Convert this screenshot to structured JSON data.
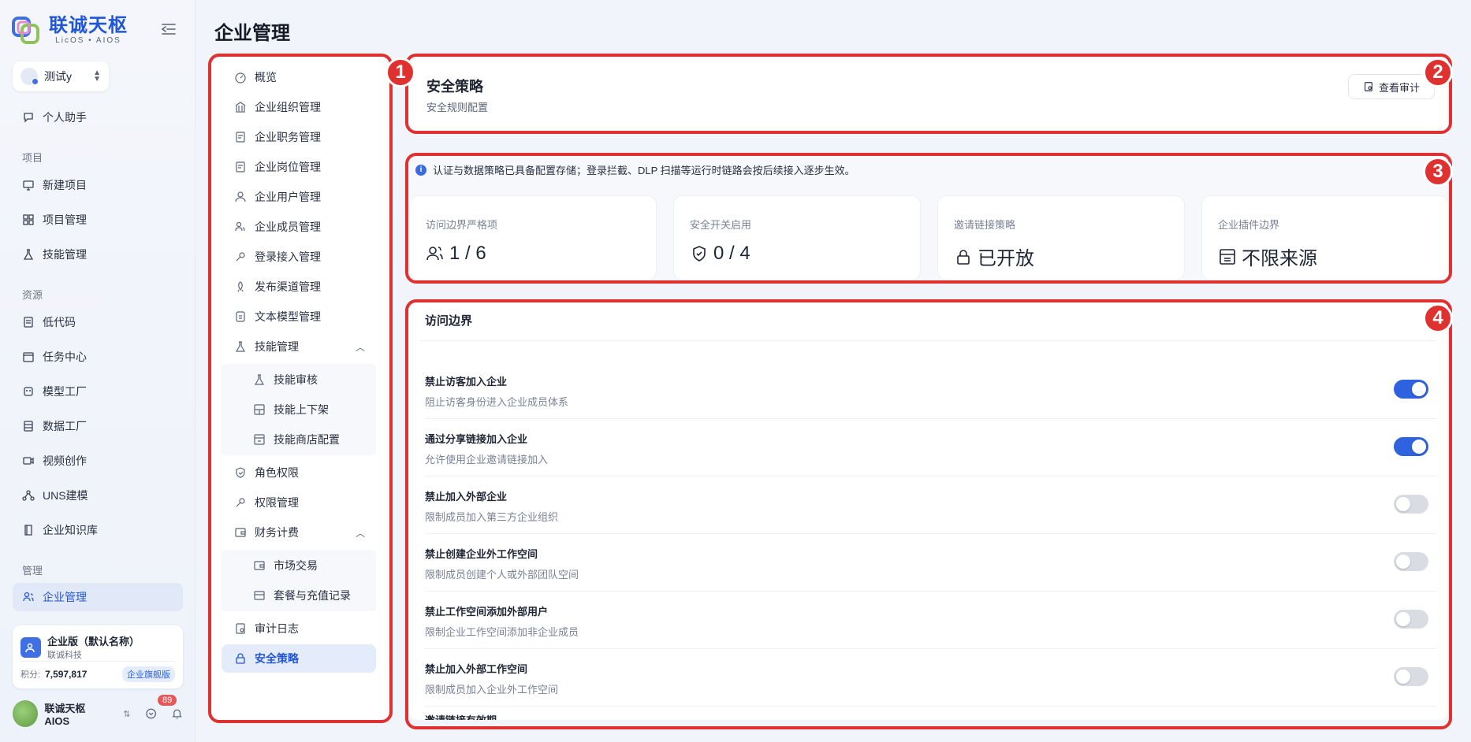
{
  "app": {
    "logo_title": "联诚天枢",
    "logo_sub": "LicOS • AIOS",
    "user_switch": "测试y"
  },
  "nav": {
    "personal": "个人助手",
    "section_project": "项目",
    "new_project": "新建项目",
    "project_mgmt": "项目管理",
    "skill_mgmt": "技能管理",
    "section_resource": "资源",
    "low_code": "低代码",
    "task_center": "任务中心",
    "model_factory": "模型工厂",
    "data_factory": "数据工厂",
    "video_creation": "视频创作",
    "uns_modeling": "UNS建模",
    "knowledge_base": "企业知识库",
    "section_manage": "管理",
    "enterprise_mgmt": "企业管理"
  },
  "enterprise_card": {
    "name": "企业版（默认名称）",
    "company": "联诚科技",
    "points_label": "积分:",
    "points_value": "7,597,817",
    "badge": "企业旗舰版"
  },
  "profile": {
    "name": "联诚天枢AIOS",
    "notifications": "89"
  },
  "page": {
    "title": "企业管理"
  },
  "annotations": [
    "1",
    "2",
    "3",
    "4"
  ],
  "menu": {
    "overview": "概览",
    "org_mgmt": "企业组织管理",
    "duty_mgmt": "企业职务管理",
    "post_mgmt": "企业岗位管理",
    "user_mgmt": "企业用户管理",
    "member_mgmt": "企业成员管理",
    "login_mgmt": "登录接入管理",
    "channel_mgmt": "发布渠道管理",
    "text_model_mgmt": "文本模型管理",
    "skill_mgmt": "技能管理",
    "skill_review": "技能审核",
    "skill_shelf": "技能上下架",
    "skill_store": "技能商店配置",
    "role_perm": "角色权限",
    "perm_mgmt": "权限管理",
    "finance": "财务计费",
    "market_trade": "市场交易",
    "package_records": "套餐与充值记录",
    "audit_log": "审计日志",
    "security_policy": "安全策略"
  },
  "security": {
    "title": "安全策略",
    "subtitle": "安全规则配置",
    "audit_button": "查看审计"
  },
  "notice": "认证与数据策略已具备配置存储；登录拦截、DLP 扫描等运行时链路会按后续接入逐步生效。",
  "stats": [
    {
      "label": "访问边界严格项",
      "value": "1 / 6",
      "icon": "users-icon"
    },
    {
      "label": "安全开关启用",
      "value": "0 / 4",
      "icon": "shield-icon"
    },
    {
      "label": "邀请链接策略",
      "value": "已开放",
      "icon": "lock-icon"
    },
    {
      "label": "企业插件边界",
      "value": "不限来源",
      "icon": "store-icon"
    }
  ],
  "access": {
    "title": "访问边界",
    "rows": [
      {
        "title": "禁止访客加入企业",
        "desc": "阻止访客身份进入企业成员体系",
        "on": true
      },
      {
        "title": "通过分享链接加入企业",
        "desc": "允许使用企业邀请链接加入",
        "on": true
      },
      {
        "title": "禁止加入外部企业",
        "desc": "限制成员加入第三方企业组织",
        "on": false
      },
      {
        "title": "禁止创建企业外工作空间",
        "desc": "限制成员创建个人或外部团队空间",
        "on": false
      },
      {
        "title": "禁止工作空间添加外部用户",
        "desc": "限制企业工作空间添加非企业成员",
        "on": false
      },
      {
        "title": "禁止加入外部工作空间",
        "desc": "限制成员加入企业外工作空间",
        "on": false
      }
    ],
    "cut_row": "邀请链接有效期"
  },
  "colors": {
    "accent": "#2f62de",
    "annotation": "#e03131",
    "active_bg": "#e4ebfb"
  }
}
